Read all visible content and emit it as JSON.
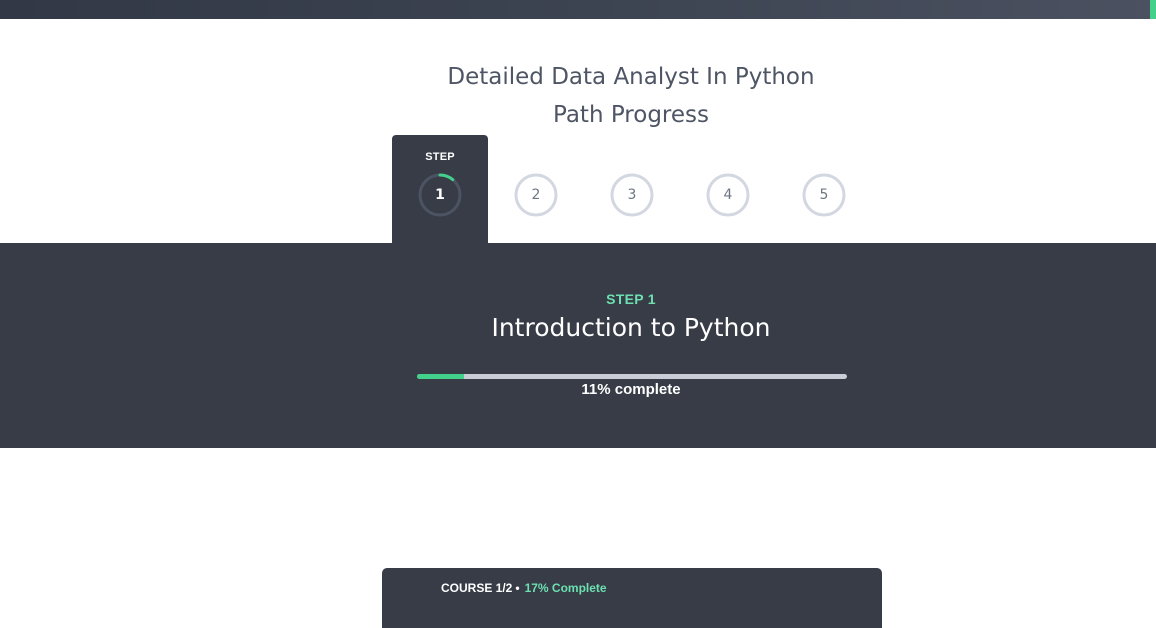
{
  "header": {
    "title_line1": "Detailed Data Analyst In Python",
    "title_line2": "Path Progress"
  },
  "stepper": {
    "active_label": "STEP",
    "steps": [
      {
        "number": "1",
        "active": true,
        "progress": 0.11
      },
      {
        "number": "2",
        "active": false,
        "progress": 0
      },
      {
        "number": "3",
        "active": false,
        "progress": 0
      },
      {
        "number": "4",
        "active": false,
        "progress": 0
      },
      {
        "number": "5",
        "active": false,
        "progress": 0
      }
    ]
  },
  "current_step": {
    "label": "STEP 1",
    "course_title": "Introduction to Python",
    "progress": 0.11,
    "progress_text": "11% complete"
  },
  "course_card": {
    "index": "COURSE 1/2",
    "separator": "•",
    "complete_text": "17% Complete"
  },
  "colors": {
    "accent": "#43d08a",
    "accent_text": "#6ce0b0",
    "dark": "#373c47",
    "ring_inactive": "#d2d7e0",
    "ring_track_active": "#4c5362"
  }
}
